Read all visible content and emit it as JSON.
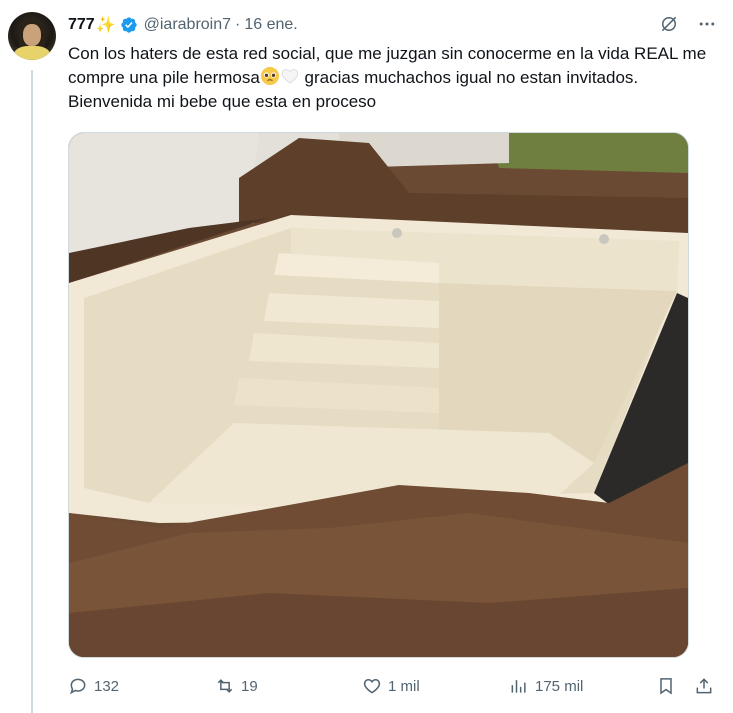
{
  "tweet": {
    "display_name": "777",
    "name_emoji": "✨",
    "handle": "@iarabroin7",
    "separator": "·",
    "timestamp": "16 ene.",
    "text_part1": "Con los haters de esta red social, que me juzgan sin conocerme en la vida REAL me compre una pile hermosa",
    "text_part2": " gracias muchachos igual no estan invitados. Bienvenida mi bebe que esta en proceso",
    "inline_emojis": [
      "pleading-face-emoji",
      "white-heart-emoji"
    ],
    "media": {
      "description_icon": "swimming-pool-photo"
    }
  },
  "actions": {
    "replies": "132",
    "reposts": "19",
    "likes": "1 mil",
    "views": "175 mil"
  },
  "colors": {
    "text": "#0f1419",
    "secondary": "#536471",
    "verified": "#1d9bf0",
    "divider": "#cfd9de"
  }
}
